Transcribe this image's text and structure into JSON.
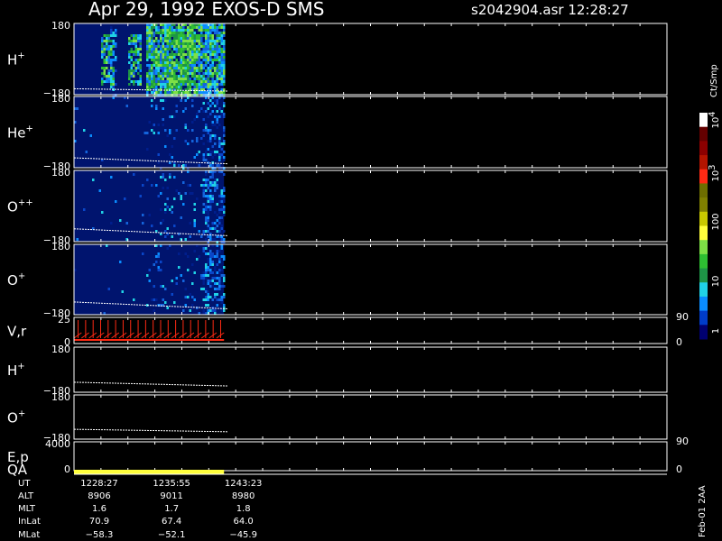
{
  "header": {
    "title": "Apr 29, 1992   EXOS-D SMS",
    "file_time": "s2042904.asr  12:28:27"
  },
  "colorbar": {
    "unit_label": "Ct/Smp",
    "tick_labels": [
      "1",
      "10",
      "100",
      "10",
      "10"
    ],
    "tick_superscripts": [
      "",
      "",
      "",
      "3",
      "4"
    ],
    "colors": [
      "#000070",
      "#003cc8",
      "#0a8cff",
      "#20d2e6",
      "#1e9446",
      "#2ebe32",
      "#7ee046",
      "#ffff3c",
      "#c8c800",
      "#808000",
      "#6e6e00",
      "#ff2a14",
      "#b41400",
      "#8c0000",
      "#640000",
      "#ffffff"
    ]
  },
  "footer": {
    "version": "Feb-01 2AA"
  },
  "chart_data": {
    "type": "heatmap",
    "panels": [
      {
        "id": "h-plus",
        "label": "H",
        "sup": "+",
        "y_top": "180",
        "y_bottom": "−180",
        "ylim": [
          -180,
          180
        ],
        "kind": "spectrogram",
        "line_y": [
          -150,
          -162
        ],
        "band": "h"
      },
      {
        "id": "he-plus",
        "label": "He",
        "sup": "+",
        "y_top": "180",
        "y_bottom": "−180",
        "ylim": [
          -180,
          180
        ],
        "kind": "spectrogram",
        "line_y": [
          -130,
          -160
        ],
        "band": "low"
      },
      {
        "id": "o-plusplus",
        "label": "O",
        "sup": "++",
        "y_top": "180",
        "y_bottom": "−180",
        "ylim": [
          -180,
          180
        ],
        "kind": "spectrogram",
        "line_y": [
          -115,
          -150
        ],
        "band": "low"
      },
      {
        "id": "o-plus",
        "label": "O",
        "sup": "+",
        "y_top": "180",
        "y_bottom": "−180",
        "ylim": [
          -180,
          180
        ],
        "kind": "spectrogram",
        "line_y": [
          -115,
          -150
        ],
        "band": "low"
      },
      {
        "id": "v-r",
        "label": "V,r",
        "sup": "",
        "y_top": "25",
        "y_bottom": "0",
        "ylim": [
          0,
          25
        ],
        "kind": "velocity",
        "right_top": "90",
        "right_bottom": "0"
      },
      {
        "id": "h-plus-2",
        "label": "H",
        "sup": "+",
        "y_top": "180",
        "y_bottom": "−180",
        "ylim": [
          -180,
          180
        ],
        "kind": "line",
        "line_y": [
          -100,
          -130
        ]
      },
      {
        "id": "o-plus-2",
        "label": "O",
        "sup": "+",
        "y_top": "180",
        "y_bottom": "−180",
        "ylim": [
          -180,
          180
        ],
        "kind": "line",
        "line_y": [
          -100,
          -120
        ]
      },
      {
        "id": "e-p",
        "label": "E,p",
        "sup": "",
        "y_top": "4000",
        "y_bottom": "0",
        "ylim": [
          0,
          4000
        ],
        "kind": "empty",
        "right_top": "90",
        "right_bottom": "0"
      }
    ],
    "qa": {
      "label": "QA",
      "bar_start_frac": 0.0,
      "bar_end_frac": 0.253,
      "color": "#ffff3c"
    },
    "ephemeris": {
      "row_labels": [
        "UT",
        "ALT",
        "MLT",
        "InLat",
        "MLat"
      ],
      "columns": [
        [
          "1228:27",
          "8906",
          "1.6",
          "70.9",
          "−58.3"
        ],
        [
          "1235:55",
          "9011",
          "1.7",
          "67.4",
          "−52.1"
        ],
        [
          "1243:23",
          "8980",
          "1.8",
          "64.0",
          "−45.9"
        ]
      ],
      "column_frac": [
        0.0,
        0.122,
        0.243
      ]
    },
    "data_extent_frac": 0.253,
    "v_period_count": 20
  }
}
